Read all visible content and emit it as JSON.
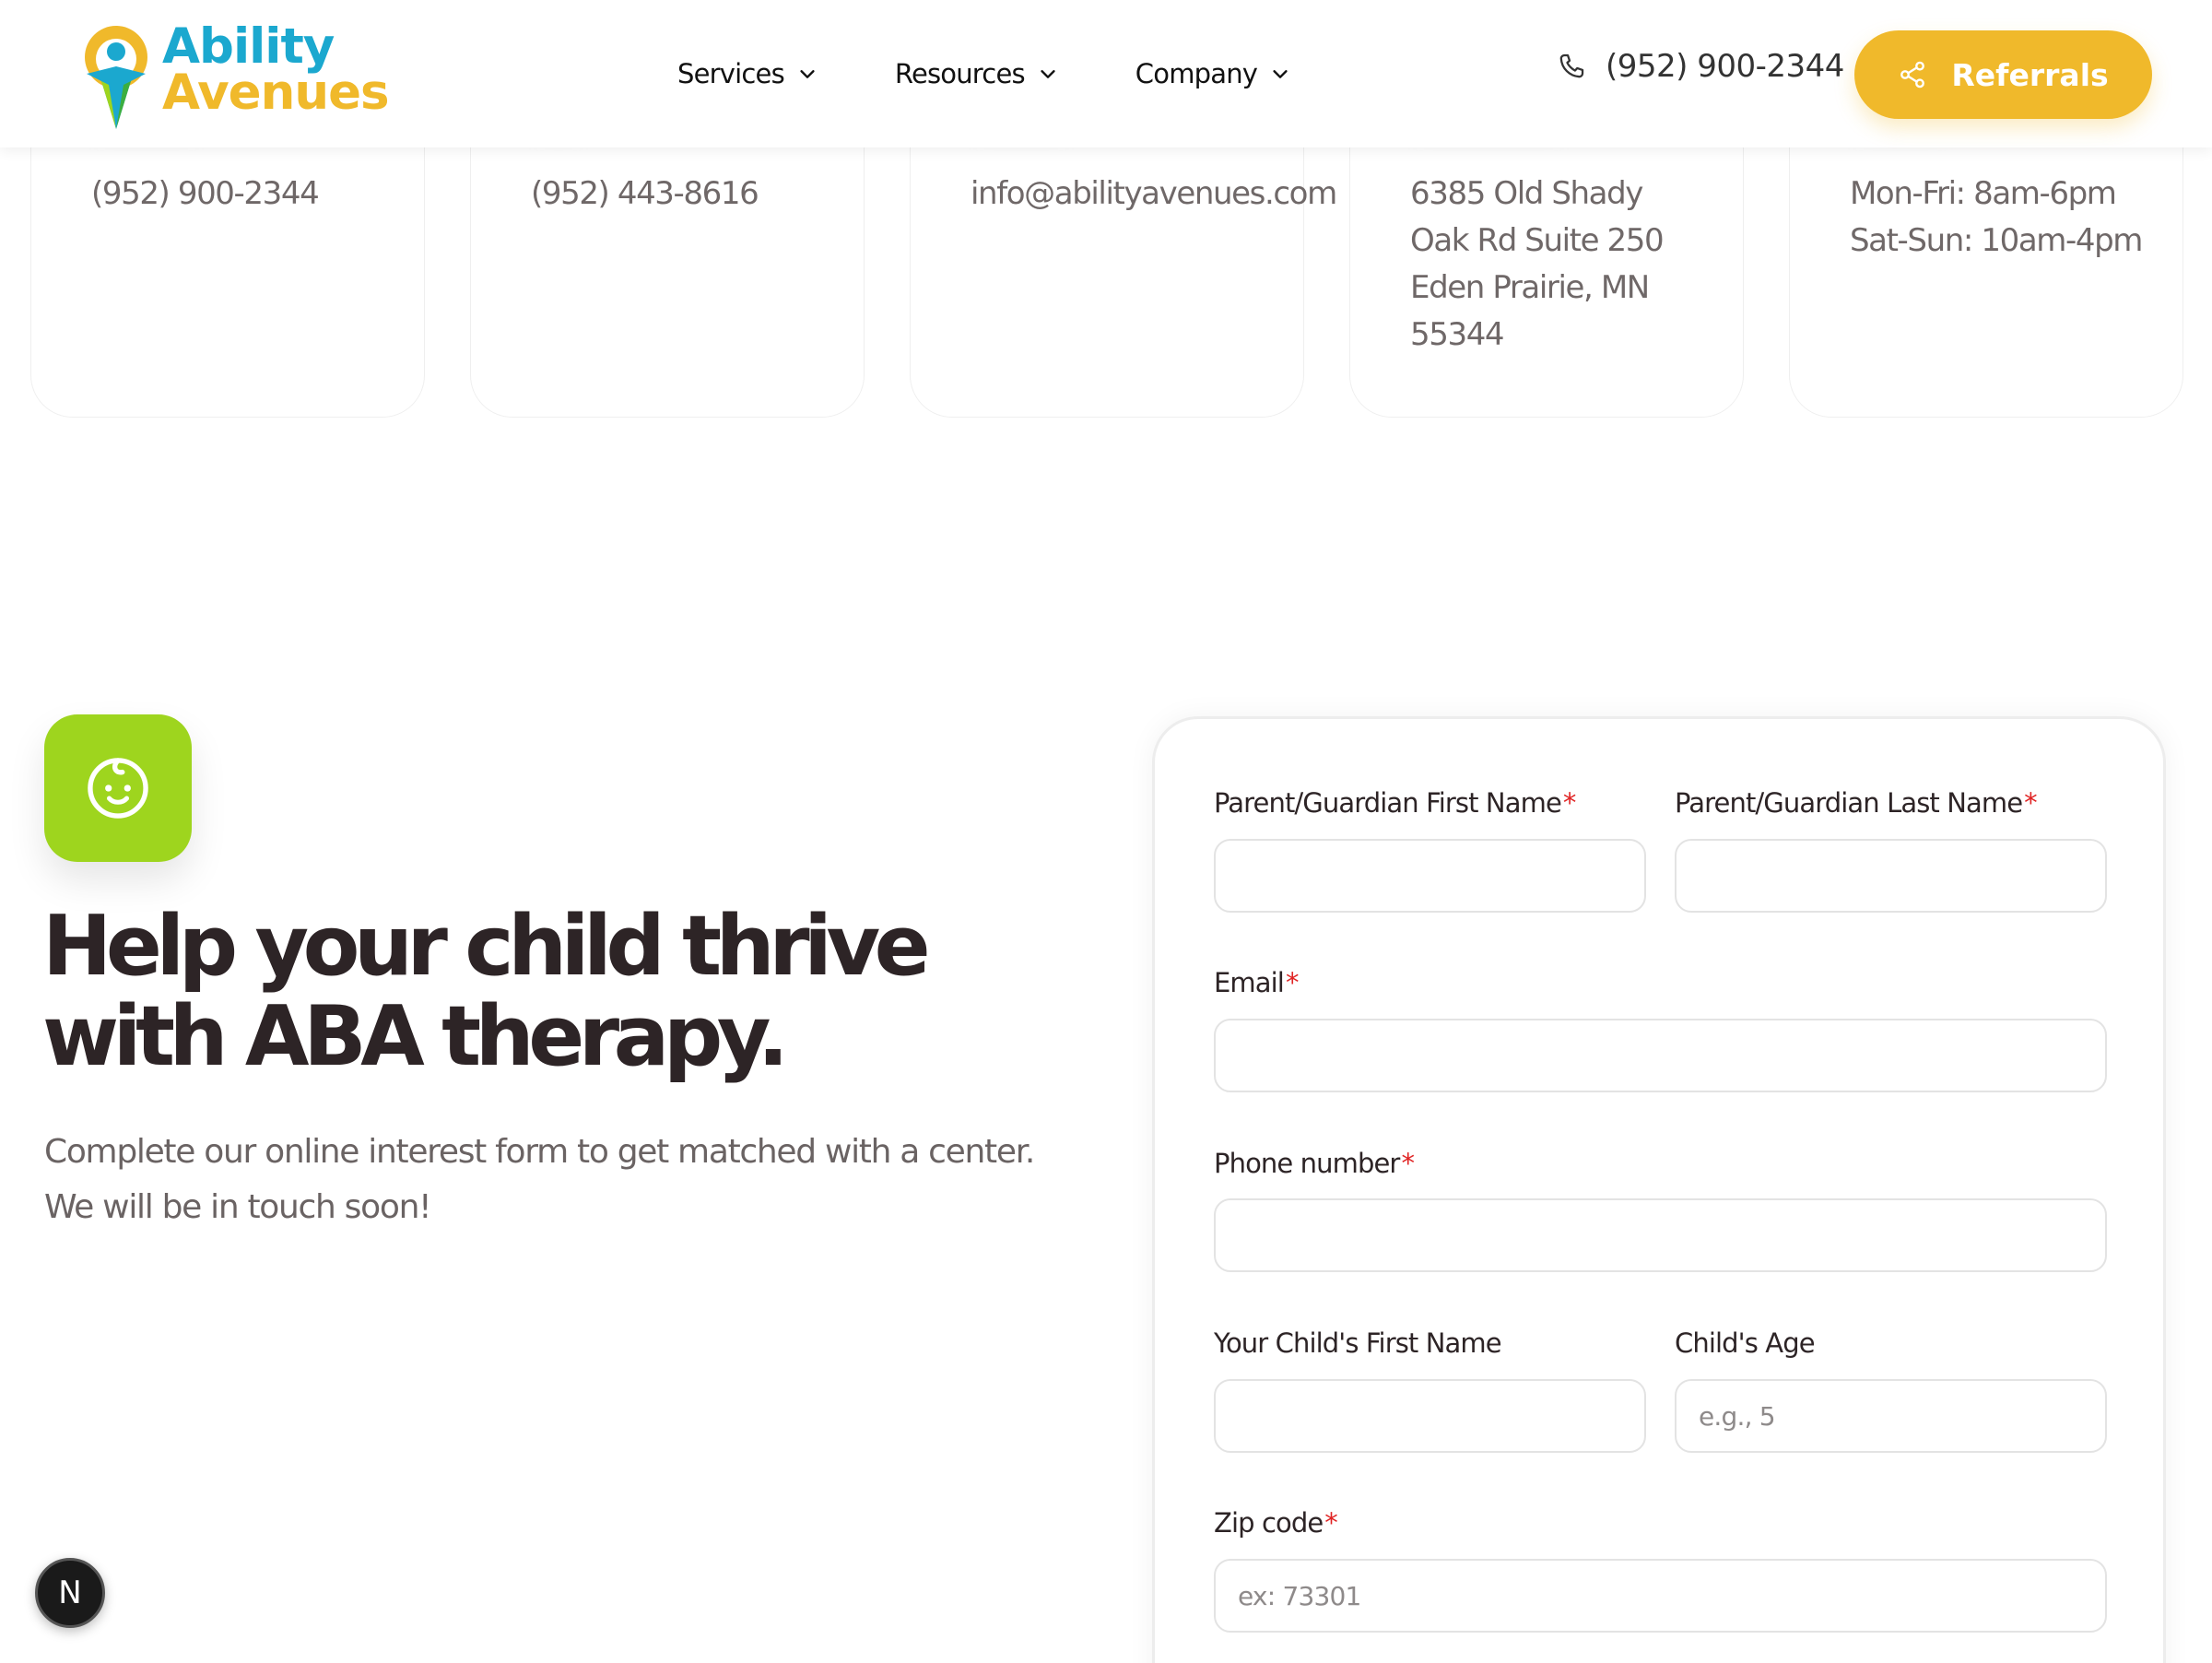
{
  "header": {
    "logo": {
      "line1": "Ability",
      "line2": "Avenues"
    },
    "nav": [
      {
        "label": "Services"
      },
      {
        "label": "Resources"
      },
      {
        "label": "Company"
      }
    ],
    "phone": "(952) 900-2344",
    "referrals_label": "Referrals"
  },
  "contact_cards": [
    {
      "text": "(952) 900-2344"
    },
    {
      "text": "(952) 443-8616"
    },
    {
      "text": "info@abilityavenues.com"
    },
    {
      "text": "6385 Old Shady\nOak Rd Suite 250\nEden Prairie, MN\n55344"
    },
    {
      "text": "Mon-Fri: 8am-6pm\nSat-Sun: 10am-4pm"
    }
  ],
  "hero": {
    "title_line1": "Help your child thrive",
    "title_line2": "with ABA therapy.",
    "subtitle_line1": "Complete our online interest form to get matched with a center.",
    "subtitle_line2": "We will be in touch soon!"
  },
  "form": {
    "parent_first_name": {
      "label": "Parent/Guardian First Name",
      "required": "*",
      "value": "",
      "placeholder": ""
    },
    "parent_last_name": {
      "label": "Parent/Guardian Last Name",
      "required": "*",
      "value": "",
      "placeholder": ""
    },
    "email": {
      "label": "Email",
      "required": "*",
      "value": "",
      "placeholder": ""
    },
    "phone": {
      "label": "Phone number",
      "required": "*",
      "value": "",
      "placeholder": ""
    },
    "child_first_name": {
      "label": "Your Child's First Name",
      "value": "",
      "placeholder": ""
    },
    "child_age": {
      "label": "Child's Age",
      "value": "",
      "placeholder": "e.g., 5"
    },
    "zip": {
      "label": "Zip code",
      "required": "*",
      "value": "",
      "placeholder": "ex: 73301"
    }
  },
  "dev_badge": {
    "letter": "N"
  },
  "colors": {
    "brand_blue": "#1ba8cf",
    "brand_yellow": "#f0b92b",
    "brand_green": "#9ed51e",
    "required_red": "#e02424",
    "heading": "#2d2426"
  },
  "icons": [
    "logo-mark-icon",
    "chevron-down-icon",
    "phone-icon",
    "share-icon",
    "baby-face-icon"
  ]
}
